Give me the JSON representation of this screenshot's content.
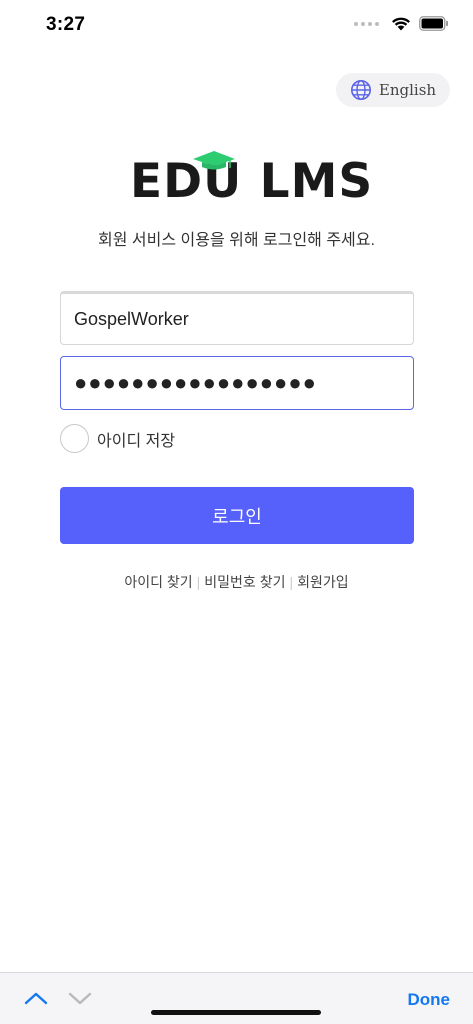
{
  "status_bar": {
    "time": "3:27",
    "icons": [
      "signal-dots-icon",
      "wifi-icon",
      "battery-icon"
    ]
  },
  "language_button": {
    "label": "English",
    "icon": "globe-icon",
    "accent_color": "#5a64e8"
  },
  "logo": {
    "text": "EDU LMS",
    "icon": "graduation-cap-icon",
    "cap_color": "#2ecc71"
  },
  "subtitle": "회원 서비스 이용을 위해 로그인해 주세요.",
  "form": {
    "username_value": "GospelWorker",
    "password_value": "●●●●●●●●●●●●●●●●●",
    "remember_label": "아이디 저장",
    "login_label": "로그인",
    "login_color": "#5660fb"
  },
  "links": {
    "find_id": "아이디 찾기",
    "find_password": "비밀번호 찾기",
    "signup": "회원가입"
  },
  "keyboard_toolbar": {
    "done_label": "Done",
    "up_icon": "chevron-up-icon",
    "down_icon": "chevron-down-icon"
  }
}
